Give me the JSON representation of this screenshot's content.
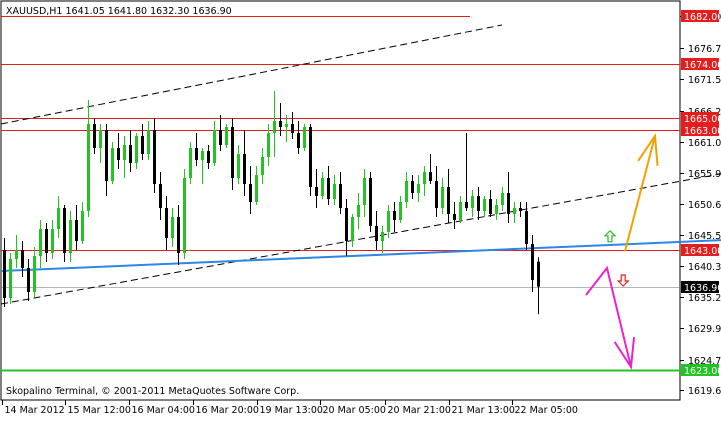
{
  "header": {
    "symbol_line": "XAUUSD,H1  1641.05 1641.80 1632.30 1636.90"
  },
  "footer": {
    "copyright": "Skopalino Terminal, © 2001-2011 MetaQuotes Software Corp."
  },
  "colors": {
    "candle_up": "#22c322",
    "candle_down": "#000000",
    "level_line": "#e41e1e",
    "trend_blue": "#2c87e6",
    "support_green": "#22c322",
    "arrow_orange": "#f5a000",
    "arrow_magenta": "#ee22cc",
    "signal_up": "#22c322",
    "signal_down": "#e41e1e"
  },
  "icons": {
    "signal_up": "up-arrow-icon",
    "signal_down": "down-arrow-icon"
  },
  "chart_data": {
    "type": "candlestick",
    "title": "XAUUSD,H1",
    "ohlc_last": {
      "open": 1641.05,
      "high": 1641.8,
      "low": 1632.3,
      "close": 1636.9
    },
    "ylim": [
      1618.0,
      1684.5
    ],
    "y_ticks": [
      1682.0,
      1676.75,
      1671.5,
      1666.25,
      1661.0,
      1655.9,
      1650.65,
      1645.55,
      1640.3,
      1635.2,
      1629.95,
      1624.7,
      1619.6
    ],
    "x_ticks": [
      "14 Mar 2012",
      "15 Mar 12:00",
      "16 Mar 04:00",
      "16 Mar 20:00",
      "19 Mar 13:00",
      "20 Mar 05:00",
      "20 Mar 21:00",
      "21 Mar 13:00",
      "22 Mar 05:00"
    ],
    "levels": [
      {
        "value": 1682.0,
        "label": "1682.00",
        "style": "red"
      },
      {
        "value": 1674.0,
        "label": "1674.00",
        "style": "red"
      },
      {
        "value": 1665.06,
        "label": "1665.06",
        "style": "red"
      },
      {
        "value": 1663.0,
        "label": "1663.00",
        "style": "red"
      },
      {
        "value": 1643.0,
        "label": "1643.00",
        "style": "red"
      },
      {
        "value": 1636.9,
        "label": "1636.90",
        "style": "current"
      },
      {
        "value": 1623.0,
        "label": "1623.00",
        "style": "green"
      }
    ],
    "candles": [
      [
        1643.0,
        1645.0,
        1633.5,
        1635.0
      ],
      [
        1635.0,
        1642.5,
        1634.0,
        1641.5
      ],
      [
        1641.5,
        1645.5,
        1640.0,
        1643.0
      ],
      [
        1643.0,
        1644.5,
        1638.5,
        1640.0
      ],
      [
        1640.0,
        1641.5,
        1634.5,
        1636.0
      ],
      [
        1636.0,
        1643.5,
        1635.0,
        1642.0
      ],
      [
        1642.0,
        1648.0,
        1640.0,
        1646.5
      ],
      [
        1646.5,
        1647.5,
        1641.0,
        1642.5
      ],
      [
        1642.5,
        1648.0,
        1641.5,
        1646.5
      ],
      [
        1646.5,
        1652.0,
        1645.0,
        1650.0
      ],
      [
        1650.0,
        1650.5,
        1641.0,
        1642.5
      ],
      [
        1642.5,
        1649.5,
        1641.0,
        1648.0
      ],
      [
        1648.0,
        1650.5,
        1643.0,
        1644.5
      ],
      [
        1644.5,
        1651.0,
        1644.0,
        1649.5
      ],
      [
        1649.5,
        1668.0,
        1648.5,
        1664.0
      ],
      [
        1664.0,
        1665.0,
        1659.0,
        1660.0
      ],
      [
        1660.0,
        1664.0,
        1657.5,
        1663.0
      ],
      [
        1663.0,
        1664.0,
        1652.0,
        1654.5
      ],
      [
        1654.5,
        1661.0,
        1654.0,
        1660.0
      ],
      [
        1660.0,
        1662.5,
        1656.5,
        1658.0
      ],
      [
        1658.0,
        1662.0,
        1655.0,
        1660.5
      ],
      [
        1660.5,
        1663.0,
        1656.0,
        1657.5
      ],
      [
        1657.5,
        1662.5,
        1656.5,
        1662.0
      ],
      [
        1662.0,
        1664.0,
        1658.0,
        1659.0
      ],
      [
        1659.0,
        1664.5,
        1658.0,
        1663.0
      ],
      [
        1663.0,
        1665.0,
        1652.5,
        1654.0
      ],
      [
        1654.0,
        1656.0,
        1648.0,
        1650.0
      ],
      [
        1650.0,
        1652.0,
        1643.0,
        1645.0
      ],
      [
        1645.0,
        1650.0,
        1643.5,
        1648.5
      ],
      [
        1648.5,
        1650.5,
        1640.5,
        1642.5
      ],
      [
        1642.5,
        1656.5,
        1641.5,
        1655.0
      ],
      [
        1655.0,
        1661.0,
        1654.0,
        1660.0
      ],
      [
        1660.0,
        1662.5,
        1657.0,
        1658.0
      ],
      [
        1658.0,
        1660.0,
        1654.0,
        1659.5
      ],
      [
        1659.5,
        1660.5,
        1656.5,
        1657.5
      ],
      [
        1657.5,
        1664.5,
        1657.0,
        1663.0
      ],
      [
        1663.0,
        1665.5,
        1659.5,
        1660.5
      ],
      [
        1660.5,
        1664.0,
        1660.0,
        1663.5
      ],
      [
        1663.5,
        1665.0,
        1653.0,
        1655.0
      ],
      [
        1655.0,
        1660.5,
        1654.0,
        1659.0
      ],
      [
        1659.0,
        1663.0,
        1652.0,
        1654.0
      ],
      [
        1654.0,
        1657.0,
        1649.0,
        1651.0
      ],
      [
        1651.0,
        1657.0,
        1650.5,
        1655.5
      ],
      [
        1655.5,
        1660.0,
        1654.0,
        1658.5
      ],
      [
        1658.5,
        1664.0,
        1657.0,
        1662.5
      ],
      [
        1662.5,
        1669.5,
        1658.5,
        1664.5
      ],
      [
        1664.5,
        1667.5,
        1662.0,
        1663.5
      ],
      [
        1663.5,
        1665.5,
        1661.0,
        1664.0
      ],
      [
        1664.0,
        1666.0,
        1661.5,
        1662.5
      ],
      [
        1662.5,
        1664.5,
        1659.0,
        1660.0
      ],
      [
        1660.0,
        1664.0,
        1659.5,
        1663.5
      ],
      [
        1663.5,
        1664.0,
        1652.0,
        1653.5
      ],
      [
        1653.5,
        1656.5,
        1650.0,
        1652.0
      ],
      [
        1652.0,
        1656.0,
        1651.5,
        1655.0
      ],
      [
        1655.0,
        1657.0,
        1650.5,
        1651.5
      ],
      [
        1651.5,
        1655.5,
        1650.5,
        1654.0
      ],
      [
        1654.0,
        1656.0,
        1649.0,
        1650.0
      ],
      [
        1650.0,
        1651.5,
        1642.0,
        1644.5
      ],
      [
        1644.5,
        1649.0,
        1643.5,
        1648.5
      ],
      [
        1648.5,
        1652.5,
        1646.5,
        1650.5
      ],
      [
        1650.5,
        1656.5,
        1648.5,
        1655.0
      ],
      [
        1655.0,
        1656.0,
        1646.0,
        1647.0
      ],
      [
        1647.0,
        1649.5,
        1643.0,
        1644.5
      ],
      [
        1644.5,
        1647.0,
        1642.5,
        1646.0
      ],
      [
        1646.0,
        1650.5,
        1645.0,
        1649.5
      ],
      [
        1649.5,
        1651.0,
        1646.0,
        1648.0
      ],
      [
        1648.0,
        1652.0,
        1647.5,
        1651.0
      ],
      [
        1651.0,
        1656.0,
        1650.0,
        1654.5
      ],
      [
        1654.5,
        1655.5,
        1651.5,
        1652.5
      ],
      [
        1652.5,
        1655.5,
        1651.0,
        1654.0
      ],
      [
        1654.0,
        1657.0,
        1652.0,
        1656.0
      ],
      [
        1656.0,
        1659.0,
        1654.0,
        1654.5
      ],
      [
        1654.5,
        1657.0,
        1648.5,
        1650.0
      ],
      [
        1650.0,
        1655.0,
        1649.0,
        1653.5
      ],
      [
        1653.5,
        1656.5,
        1647.5,
        1649.0
      ],
      [
        1649.0,
        1651.0,
        1646.5,
        1648.0
      ],
      [
        1648.0,
        1652.0,
        1647.5,
        1651.0
      ],
      [
        1651.0,
        1662.5,
        1649.5,
        1650.0
      ],
      [
        1650.0,
        1653.0,
        1648.5,
        1652.0
      ],
      [
        1652.0,
        1653.5,
        1648.0,
        1649.5
      ],
      [
        1649.5,
        1652.0,
        1648.5,
        1651.5
      ],
      [
        1651.5,
        1653.0,
        1648.5,
        1649.0
      ],
      [
        1649.0,
        1651.5,
        1648.0,
        1650.5
      ],
      [
        1650.5,
        1653.5,
        1649.5,
        1652.5
      ],
      [
        1652.5,
        1656.0,
        1647.5,
        1649.0
      ],
      [
        1649.0,
        1651.0,
        1647.5,
        1650.0
      ],
      [
        1650.0,
        1651.0,
        1648.5,
        1649.5
      ],
      [
        1649.5,
        1651.0,
        1643.0,
        1644.0
      ],
      [
        1644.0,
        1645.5,
        1636.0,
        1638.0
      ],
      [
        1641.05,
        1641.8,
        1632.3,
        1636.9
      ]
    ],
    "trendlines": [
      {
        "name": "upper-channel",
        "style": "dashed",
        "from": [
          -0.5,
          1664.0
        ],
        "to": [
          83.0,
          1680.5
        ]
      },
      {
        "name": "lower-channel",
        "style": "dashed",
        "from": [
          -0.5,
          1634.0
        ],
        "to": [
          124.0,
          1656.5
        ]
      },
      {
        "name": "blue-trendline",
        "style": "solid-blue",
        "from": [
          -0.5,
          1639.5
        ],
        "to": [
          121.0,
          1644.7
        ]
      }
    ],
    "signals": [
      {
        "type": "up",
        "bar": 101.0,
        "price": 1645.2
      },
      {
        "type": "down",
        "bar": 103.2,
        "price": 1638.0
      }
    ],
    "projection_arrows": [
      {
        "color": "orange",
        "points": [
          [
            103.5,
            1642.8
          ],
          [
            108.5,
            1662.0
          ]
        ]
      },
      {
        "color": "magenta",
        "points": [
          [
            97.0,
            1635.5
          ],
          [
            100.5,
            1640.0
          ],
          [
            104.5,
            1623.5
          ]
        ]
      }
    ]
  }
}
